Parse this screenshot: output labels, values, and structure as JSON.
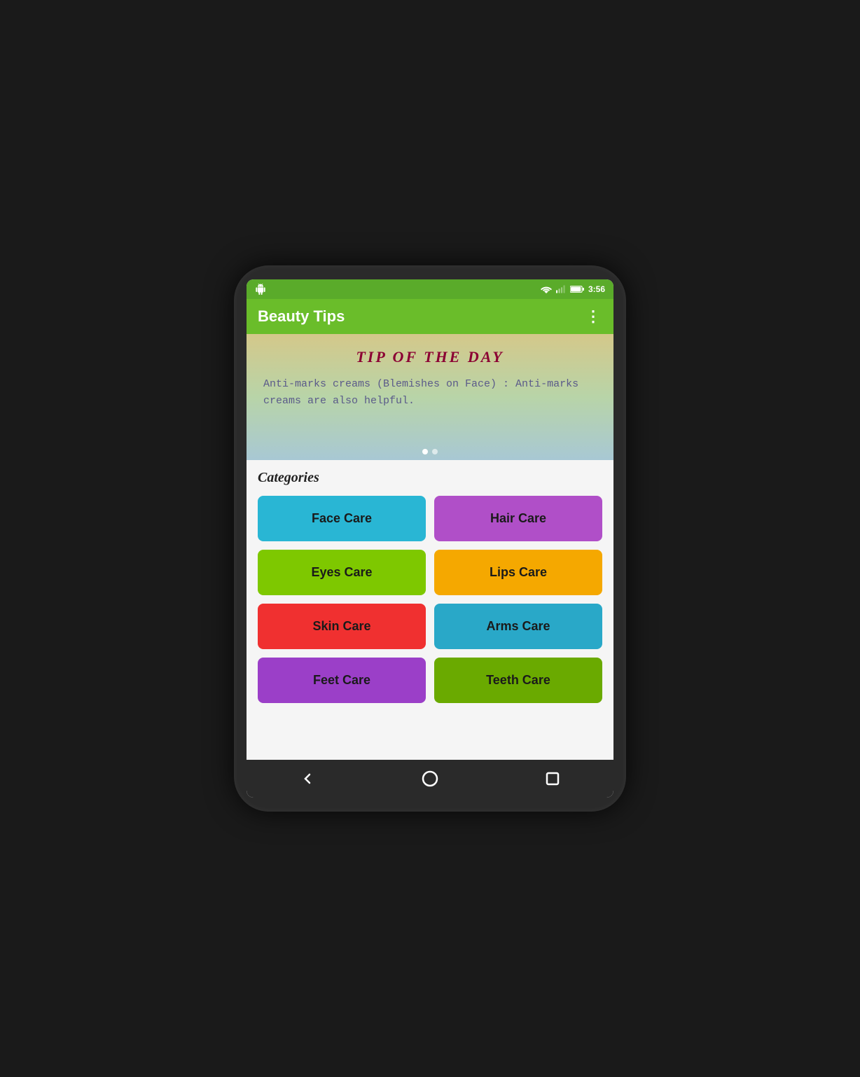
{
  "status_bar": {
    "time": "3:56"
  },
  "app_bar": {
    "title": "Beauty Tips",
    "more_icon": "⋮"
  },
  "banner": {
    "tip_title": "TIP OF THE DAY",
    "tip_text": "Anti-marks creams (Blemishes on Face) : Anti-marks creams are also helpful."
  },
  "categories": {
    "heading": "Categories",
    "items": [
      {
        "label": "Face Care",
        "class": "btn-face-care"
      },
      {
        "label": "Hair Care",
        "class": "btn-hair-care"
      },
      {
        "label": "Eyes Care",
        "class": "btn-eyes-care"
      },
      {
        "label": "Lips Care",
        "class": "btn-lips-care"
      },
      {
        "label": "Skin Care",
        "class": "btn-skin-care"
      },
      {
        "label": "Arms Care",
        "class": "btn-arms-care"
      },
      {
        "label": "Feet Care",
        "class": "btn-feet-care"
      },
      {
        "label": "Teeth Care",
        "class": "btn-teeth-care"
      }
    ]
  }
}
